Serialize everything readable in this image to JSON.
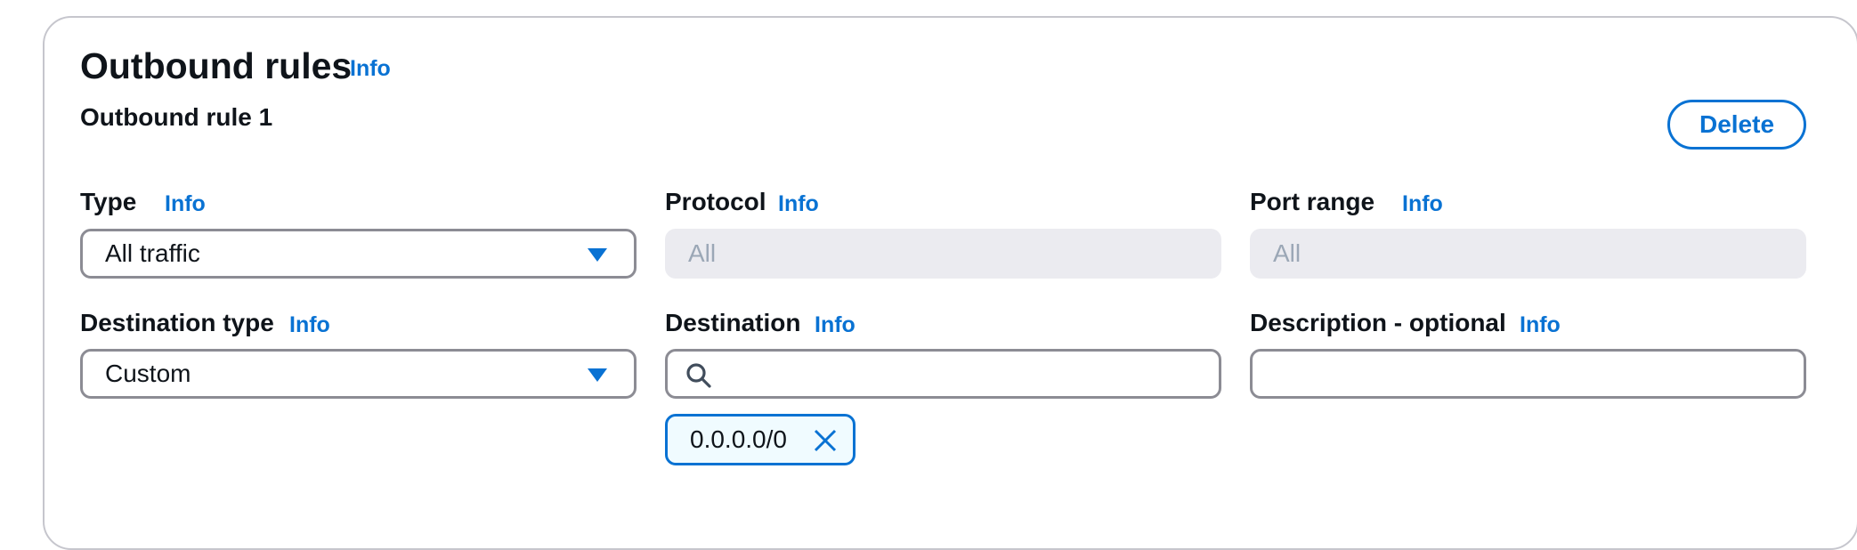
{
  "section": {
    "title": "Outbound rules",
    "title_info": "Info",
    "rule_title": "Outbound rule 1",
    "delete_label": "Delete"
  },
  "fields": {
    "type": {
      "label": "Type",
      "info": "Info",
      "value": "All traffic"
    },
    "protocol": {
      "label": "Protocol",
      "info": "Info",
      "value": "All"
    },
    "port_range": {
      "label": "Port range",
      "info": "Info",
      "value": "All"
    },
    "destination_type": {
      "label": "Destination type",
      "info": "Info",
      "value": "Custom"
    },
    "destination": {
      "label": "Destination",
      "info": "Info",
      "value": "",
      "token": "0.0.0.0/0"
    },
    "description": {
      "label": "Description - optional",
      "info": "Info",
      "value": ""
    }
  },
  "icons": {
    "dropdown": "caret-down-icon",
    "search": "search-icon",
    "remove_token": "close-icon"
  },
  "colors": {
    "accent": "#0972d3",
    "border": "#8c8c94",
    "disabled_bg": "#ebebf0",
    "disabled_text": "#9ba7b6",
    "token_bg": "#f0fbff"
  }
}
